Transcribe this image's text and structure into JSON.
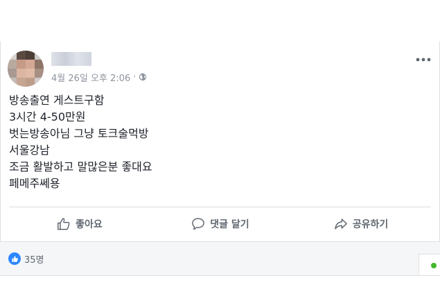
{
  "post": {
    "timestamp": "4월 26일 오후 2:06",
    "separator": "·",
    "privacy_icon": "globe-icon",
    "menu_icon": "more-horizontal-icon",
    "lines": [
      "방송출연 게스트구함",
      "3시간 4-50만원",
      "벗는방송아님 그냥 토크술먹방",
      "서울강남",
      "조금 활발하고 말많은분 좋대요",
      "페메주쎄용"
    ]
  },
  "actions": {
    "like_label": "좋아요",
    "comment_label": "댓글 달기",
    "share_label": "공유하기"
  },
  "reactions": {
    "count": "35명",
    "icon": "like-reaction-icon",
    "accent_color": "#2d88ff"
  },
  "chat": {
    "status_color": "#42b72a"
  }
}
